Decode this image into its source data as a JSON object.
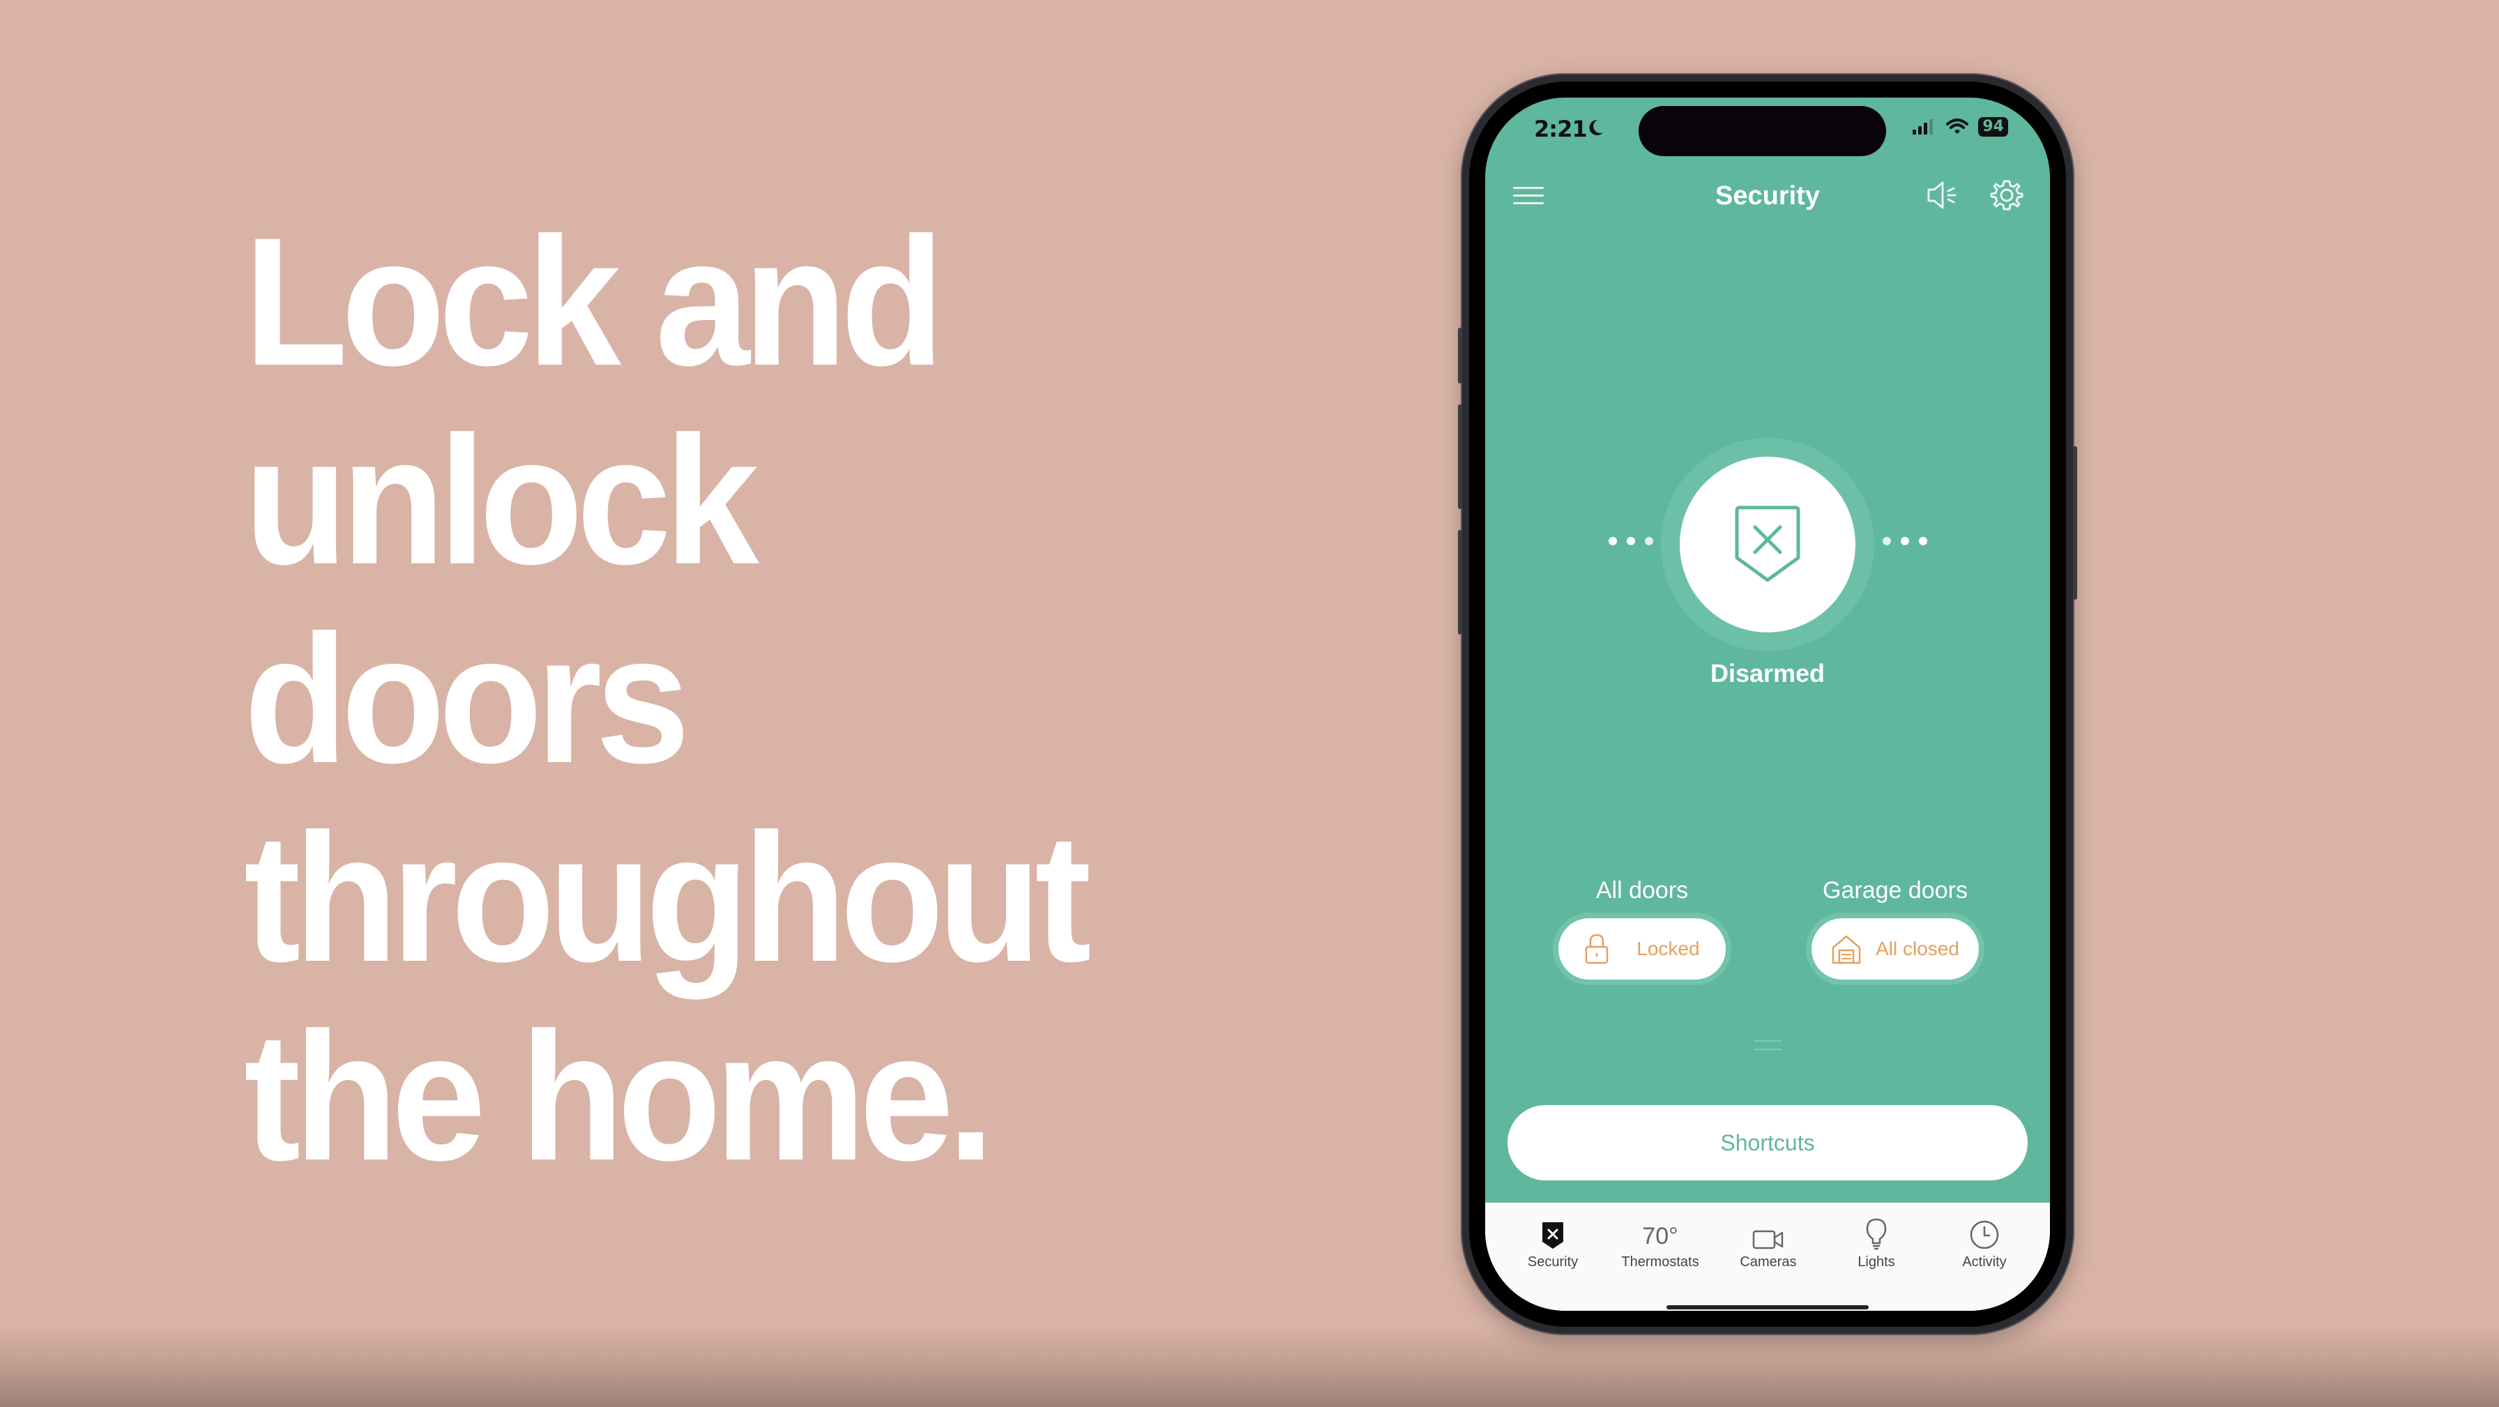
{
  "headline": {
    "lines": [
      "Lock and",
      "unlock",
      "doors",
      "throughout",
      "the home."
    ]
  },
  "colors": {
    "background": "#d9b3a6",
    "app_primary": "#5fb79d",
    "accent_orange": "#e5a05c",
    "headline_text": "#ffffff"
  },
  "phone": {
    "status_bar": {
      "time": "2:21",
      "focus_icon": "moon-icon",
      "signal_icon": "cellular-signal-icon",
      "wifi_icon": "wifi-icon",
      "battery": "94"
    },
    "header": {
      "title": "Security",
      "menu_icon": "hamburger-menu-icon",
      "speaker_icon": "speaker-icon",
      "settings_icon": "gear-icon"
    },
    "arm_control": {
      "icon": "shield-x-icon",
      "status": "Disarmed"
    },
    "doors": [
      {
        "label": "All doors",
        "status": "Locked",
        "icon": "padlock-icon"
      },
      {
        "label": "Garage doors",
        "status": "All closed",
        "icon": "garage-icon"
      }
    ],
    "shortcuts_label": "Shortcuts",
    "tabs": [
      {
        "label": "Security",
        "icon": "shield-x-icon",
        "active": true
      },
      {
        "label": "Thermostats",
        "value": "70°",
        "active": false
      },
      {
        "label": "Cameras",
        "icon": "video-camera-icon",
        "active": false
      },
      {
        "label": "Lights",
        "icon": "lightbulb-icon",
        "active": false
      },
      {
        "label": "Activity",
        "icon": "clock-icon",
        "active": false
      }
    ]
  }
}
